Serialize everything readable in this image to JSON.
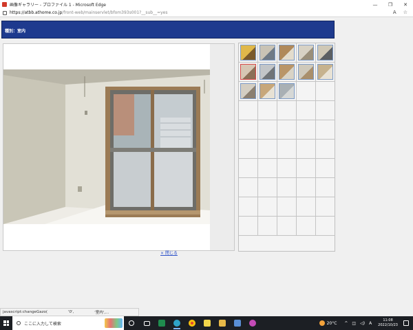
{
  "window": {
    "title": "画像ギャラリー - プロファイル 1 - Microsoft Edge",
    "minimize": "—",
    "restore": "❐",
    "close": "✕"
  },
  "addressbar": {
    "url_domain": "https://atbb.athome.co.jp",
    "url_rest": "/front-web/mainservlet/bfom393s001?__sub__=yes",
    "icon_reader": "A",
    "icon_favorites": "☆"
  },
  "page": {
    "header_label": "種別：室内",
    "close_link": "× 閉じる",
    "thumbnail_count": 13,
    "selected_thumbnail": 6,
    "grid_columns": 5,
    "grid_rows": 10
  },
  "status": {
    "left": "javascript:changeGazo(",
    "mid": "'0',",
    "right": "'室内',..."
  },
  "taskbar": {
    "search_placeholder": "ここに入力して検索",
    "weather": "20°C",
    "ime": "A",
    "time": "11:08",
    "date": "2022/10/23"
  },
  "colors": {
    "header_bg": "#1e3a8e",
    "selected_border": "#d84a4a",
    "thumb_border": "#7d9bc6",
    "link": "#2a4fc8"
  }
}
